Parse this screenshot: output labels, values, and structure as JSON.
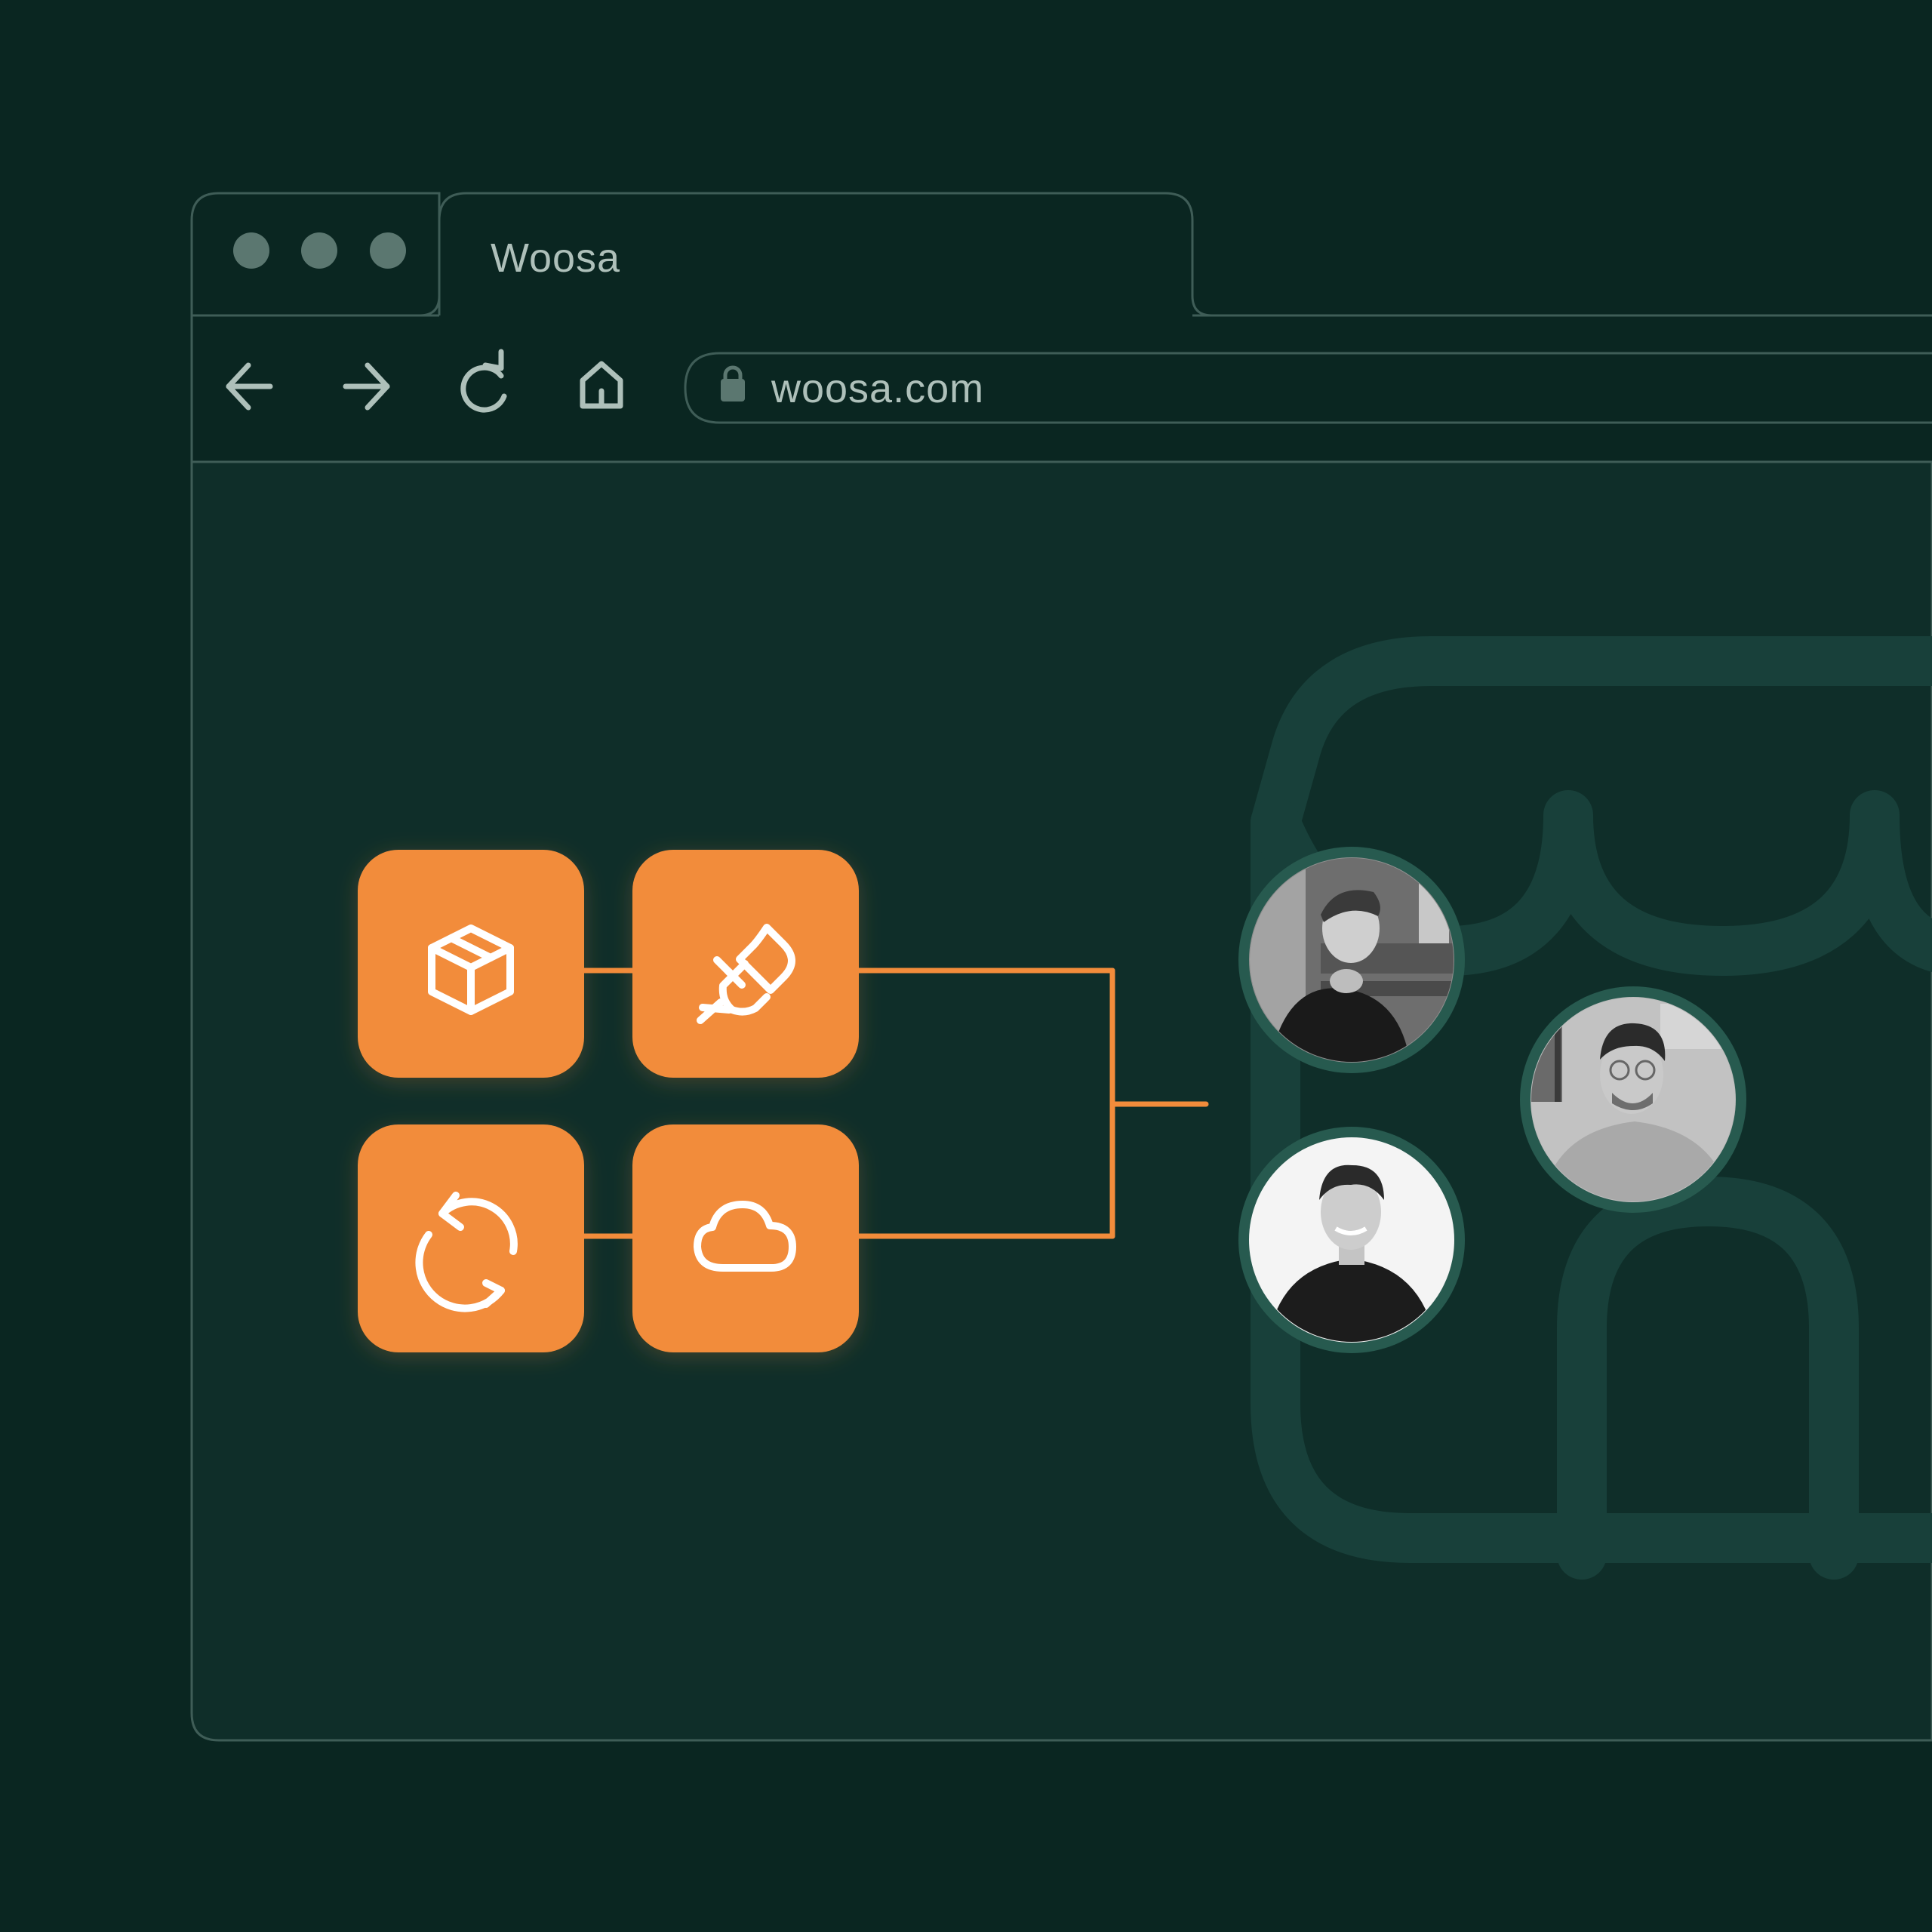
{
  "colors": {
    "page_background": "#0a2621",
    "window_background": "#0f2e29",
    "window_border": "#3f5d57",
    "text": "#aec0ba",
    "traffic_light": "#5b7770",
    "accent_orange": "#f28c3b",
    "icon_stroke": "#ffffff",
    "avatar_ring": "#275a4f",
    "store_outline": "#18403a"
  },
  "browser": {
    "tab": {
      "title": "Woosa"
    },
    "nav": {
      "back_icon": "arrow-left-icon",
      "forward_icon": "arrow-right-icon",
      "reload_icon": "reload-icon",
      "home_icon": "home-icon"
    },
    "address_bar": {
      "lock_icon": "lock-icon",
      "url": "woosa.com"
    }
  },
  "content": {
    "tiles": [
      {
        "icon": "box-icon"
      },
      {
        "icon": "plug-icon"
      },
      {
        "icon": "sync-icon"
      },
      {
        "icon": "cloud-icon"
      }
    ],
    "avatars": [
      {
        "name": "team-member-1"
      },
      {
        "name": "team-member-2"
      },
      {
        "name": "team-member-3"
      }
    ],
    "background_illustration": "storefront-outline"
  }
}
